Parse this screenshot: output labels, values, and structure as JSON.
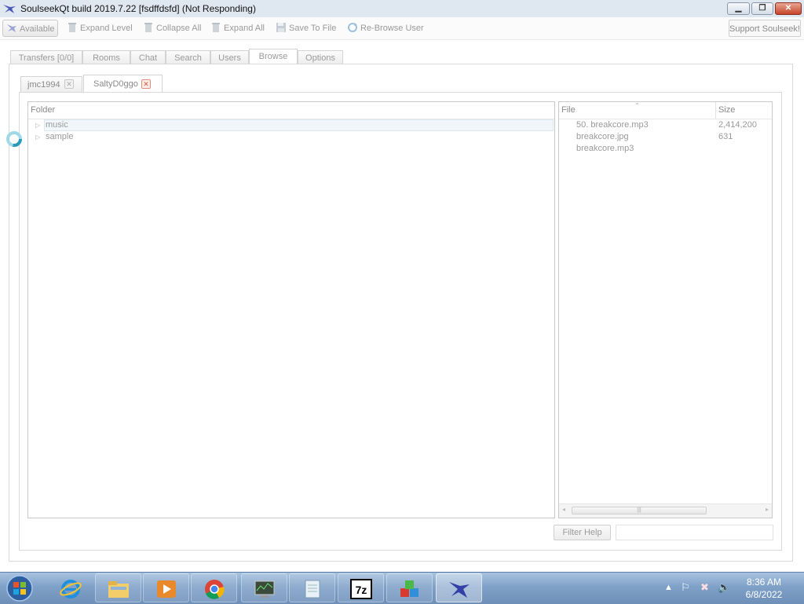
{
  "window": {
    "title": "SoulseekQt build 2019.7.22 [fsdffdsfd] (Not Responding)",
    "min_glyph": "▁",
    "max_glyph": "❐",
    "close_glyph": "✕"
  },
  "toolbar": {
    "available": "Available",
    "expand_level": "Expand Level",
    "collapse_all": "Collapse All",
    "expand_all": "Expand All",
    "save_to_file": "Save To File",
    "rebrowse_user": "Re-Browse User",
    "support": "Support Soulseek!"
  },
  "main_tabs": [
    "Transfers [0/0]",
    "Rooms",
    "Chat",
    "Search",
    "Users",
    "Browse",
    "Options"
  ],
  "active_main_tab": "Browse",
  "user_tabs": [
    "jmc1994",
    "SaltyD0ggo"
  ],
  "active_user_tab": "SaltyD0ggo",
  "folder_pane": {
    "header": "Folder",
    "items": [
      {
        "label": "music",
        "selected": true
      },
      {
        "label": "sample",
        "selected": false
      }
    ]
  },
  "file_pane": {
    "col_file": "File",
    "col_size": "Size",
    "rows": [
      {
        "name": "50. breakcore.mp3",
        "size": "2,414,200"
      },
      {
        "name": "breakcore.jpg",
        "size": "631"
      },
      {
        "name": "breakcore.mp3",
        "size": ""
      }
    ]
  },
  "filter": {
    "help_label": "Filter Help",
    "value": ""
  },
  "taskbar": {
    "apps": [
      "internet-explorer",
      "file-explorer",
      "media-player",
      "chrome",
      "system-monitor",
      "notepad",
      "7zip",
      "blocks-app",
      "soulseek"
    ],
    "time": "8:36 AM",
    "date": "6/8/2022"
  },
  "colors": {
    "titlebar": "#dfe7f1",
    "taskbar": "#7fa1c8",
    "close_button": "#c7432b"
  }
}
